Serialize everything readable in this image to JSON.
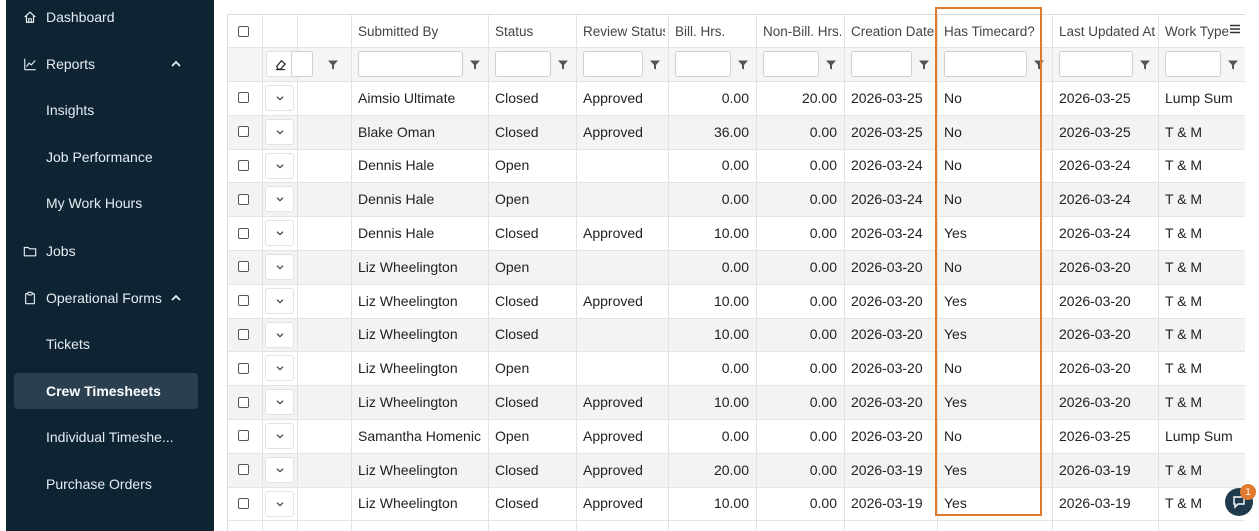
{
  "sidebar": {
    "dashboard": "Dashboard",
    "reports": "Reports",
    "insights": "Insights",
    "job_performance": "Job Performance",
    "my_work_hours": "My Work Hours",
    "jobs": "Jobs",
    "operational_forms": "Operational Forms",
    "tickets": "Tickets",
    "crew_timesheets": "Crew Timesheets",
    "individual_timesheets": "Individual Timeshe...",
    "purchase_orders": "Purchase Orders"
  },
  "grid": {
    "columns": {
      "submitted_by": "Submitted By",
      "status": "Status",
      "review_status": "Review Status",
      "bill_hrs": "Bill. Hrs.",
      "non_bill_hrs": "Non-Bill. Hrs.",
      "creation_date": "Creation Date",
      "has_timecard": "Has Timecard?",
      "last_updated_at": "Last Updated At",
      "work_type": "Work Type"
    },
    "rows": [
      {
        "submitted_by": "Aimsio Ultimate",
        "status": "Closed",
        "review_status": "Approved",
        "bill_hrs": "0.00",
        "non_bill_hrs": "20.00",
        "creation_date": "2026-03-25",
        "has_timecard": "No",
        "last_updated_at": "2026-03-25",
        "work_type": "Lump Sum"
      },
      {
        "submitted_by": "Blake Oman",
        "status": "Closed",
        "review_status": "Approved",
        "bill_hrs": "36.00",
        "non_bill_hrs": "0.00",
        "creation_date": "2026-03-25",
        "has_timecard": "No",
        "last_updated_at": "2026-03-25",
        "work_type": "T & M"
      },
      {
        "submitted_by": "Dennis Hale",
        "status": "Open",
        "review_status": "",
        "bill_hrs": "0.00",
        "non_bill_hrs": "0.00",
        "creation_date": "2026-03-24",
        "has_timecard": "No",
        "last_updated_at": "2026-03-24",
        "work_type": "T & M"
      },
      {
        "submitted_by": "Dennis Hale",
        "status": "Open",
        "review_status": "",
        "bill_hrs": "0.00",
        "non_bill_hrs": "0.00",
        "creation_date": "2026-03-24",
        "has_timecard": "No",
        "last_updated_at": "2026-03-24",
        "work_type": "T & M"
      },
      {
        "submitted_by": "Dennis Hale",
        "status": "Closed",
        "review_status": "Approved",
        "bill_hrs": "10.00",
        "non_bill_hrs": "0.00",
        "creation_date": "2026-03-24",
        "has_timecard": "Yes",
        "last_updated_at": "2026-03-24",
        "work_type": "T & M"
      },
      {
        "submitted_by": "Liz Wheelington",
        "status": "Open",
        "review_status": "",
        "bill_hrs": "0.00",
        "non_bill_hrs": "0.00",
        "creation_date": "2026-03-20",
        "has_timecard": "No",
        "last_updated_at": "2026-03-20",
        "work_type": "T & M"
      },
      {
        "submitted_by": "Liz Wheelington",
        "status": "Closed",
        "review_status": "Approved",
        "bill_hrs": "10.00",
        "non_bill_hrs": "0.00",
        "creation_date": "2026-03-20",
        "has_timecard": "Yes",
        "last_updated_at": "2026-03-20",
        "work_type": "T & M"
      },
      {
        "submitted_by": "Liz Wheelington",
        "status": "Closed",
        "review_status": "",
        "bill_hrs": "10.00",
        "non_bill_hrs": "0.00",
        "creation_date": "2026-03-20",
        "has_timecard": "Yes",
        "last_updated_at": "2026-03-20",
        "work_type": "T & M"
      },
      {
        "submitted_by": "Liz Wheelington",
        "status": "Open",
        "review_status": "",
        "bill_hrs": "0.00",
        "non_bill_hrs": "0.00",
        "creation_date": "2026-03-20",
        "has_timecard": "No",
        "last_updated_at": "2026-03-20",
        "work_type": "T & M"
      },
      {
        "submitted_by": "Liz Wheelington",
        "status": "Closed",
        "review_status": "Approved",
        "bill_hrs": "10.00",
        "non_bill_hrs": "0.00",
        "creation_date": "2026-03-20",
        "has_timecard": "Yes",
        "last_updated_at": "2026-03-20",
        "work_type": "T & M"
      },
      {
        "submitted_by": "Samantha Homenick",
        "status": "Open",
        "review_status": "Approved",
        "bill_hrs": "0.00",
        "non_bill_hrs": "0.00",
        "creation_date": "2026-03-20",
        "has_timecard": "No",
        "last_updated_at": "2026-03-25",
        "work_type": "Lump Sum"
      },
      {
        "submitted_by": "Liz Wheelington",
        "status": "Closed",
        "review_status": "Approved",
        "bill_hrs": "20.00",
        "non_bill_hrs": "0.00",
        "creation_date": "2026-03-19",
        "has_timecard": "Yes",
        "last_updated_at": "2026-03-19",
        "work_type": "T & M"
      },
      {
        "submitted_by": "Liz Wheelington",
        "status": "Closed",
        "review_status": "Approved",
        "bill_hrs": "10.00",
        "non_bill_hrs": "0.00",
        "creation_date": "2026-03-19",
        "has_timecard": "Yes",
        "last_updated_at": "2026-03-19",
        "work_type": "T & M"
      }
    ]
  },
  "chat": {
    "badge_count": "1"
  },
  "colors": {
    "sidebar_bg": "#0e2433",
    "highlight": "#e07a2f",
    "active_item": "#2a3f50"
  }
}
